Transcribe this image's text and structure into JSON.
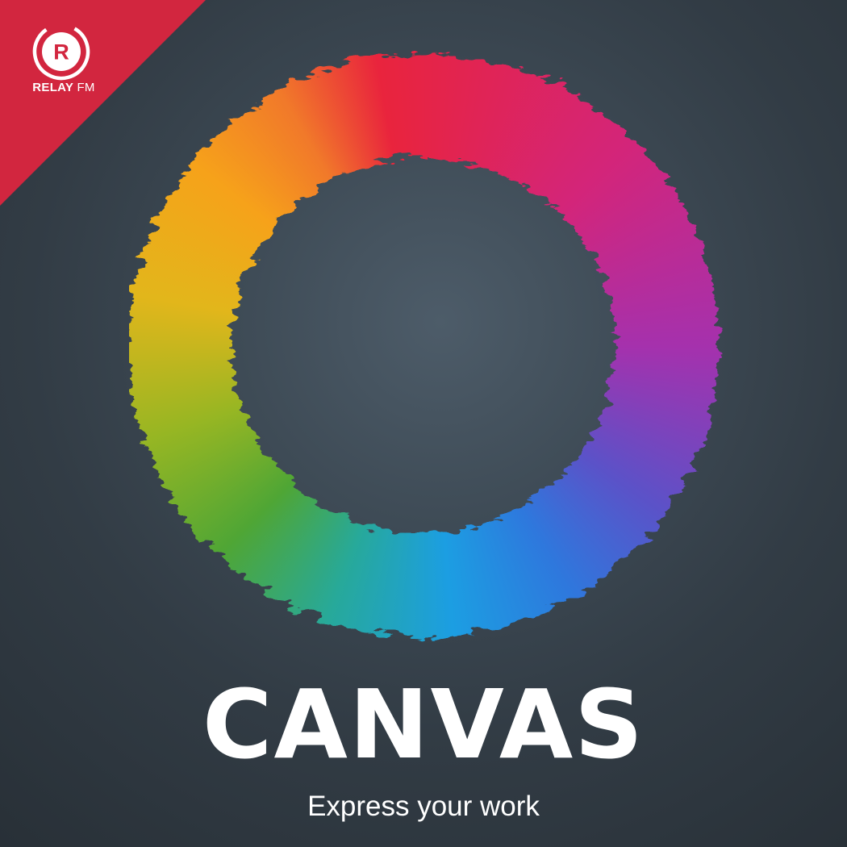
{
  "network": {
    "logo_letter": "R",
    "name_bold": "RELAY",
    "name_light": "FM"
  },
  "show": {
    "title": "CANVAS",
    "tagline": "Express your work"
  },
  "colors": {
    "background": "#3a4650",
    "banner": "#d2263f",
    "text": "#ffffff",
    "ring_stops": [
      "#f5a21a",
      "#ef7324",
      "#e42a3c",
      "#d0267a",
      "#9a34b6",
      "#3b6fd6",
      "#1c9de0",
      "#27a89a",
      "#5aa832",
      "#c7c21a",
      "#f6b81c"
    ]
  },
  "icons": [
    "relay-fm-logo-icon",
    "paint-ring-icon"
  ]
}
